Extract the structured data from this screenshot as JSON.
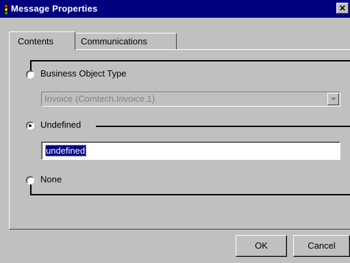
{
  "window": {
    "title": "Message Properties",
    "close_label": "✕"
  },
  "tabs": [
    {
      "label": "Contents",
      "active": true
    },
    {
      "label": "Communications",
      "active": false
    }
  ],
  "content": {
    "options": [
      {
        "label": "Business Object Type",
        "selected": false
      },
      {
        "label": "Undefined",
        "selected": true
      },
      {
        "label": "None",
        "selected": false
      }
    ],
    "business_object_combo": {
      "value": "Invoice  (Comtech.Invoice.1)",
      "enabled": false
    },
    "undefined_field": {
      "value": "undefined",
      "selected_text": true
    }
  },
  "buttons": {
    "ok": "OK",
    "cancel": "Cancel"
  },
  "colors": {
    "titlebar": "#000080",
    "face": "#c0c0c0",
    "selection": "#000080"
  }
}
